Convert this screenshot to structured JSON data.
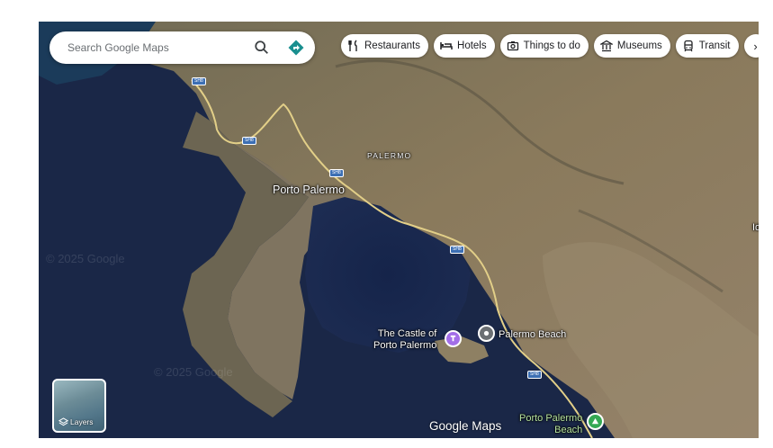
{
  "search": {
    "placeholder": "Search Google Maps"
  },
  "chips": [
    {
      "label": "Restaurants",
      "icon": "restaurant-icon"
    },
    {
      "label": "Hotels",
      "icon": "hotel-icon"
    },
    {
      "label": "Things to do",
      "icon": "camera-icon"
    },
    {
      "label": "Museums",
      "icon": "museum-icon"
    },
    {
      "label": "Transit",
      "icon": "transit-icon"
    }
  ],
  "more_chips_glyph": "›",
  "road_shield": "SH8",
  "places": {
    "town": "Porto Palermo",
    "area": "PALERMO",
    "castle_line1": "The Castle of",
    "castle_line2": "Porto Palermo",
    "beach": "Palermo Beach",
    "beach2_line1": "Porto Palermo",
    "beach2_line2": "Beach",
    "edge_fragment": "Id"
  },
  "watermarks": [
    "© 2025 Google",
    "© 2025 Google"
  ],
  "layers_label": "Layers",
  "logo": "Google Maps",
  "colors": {
    "sea": "#1c2a4a",
    "castle_pin": "#a36ee8",
    "beach_pin": "#5f6368",
    "park_pin": "#34a853",
    "shield": "#3c6fb4"
  }
}
